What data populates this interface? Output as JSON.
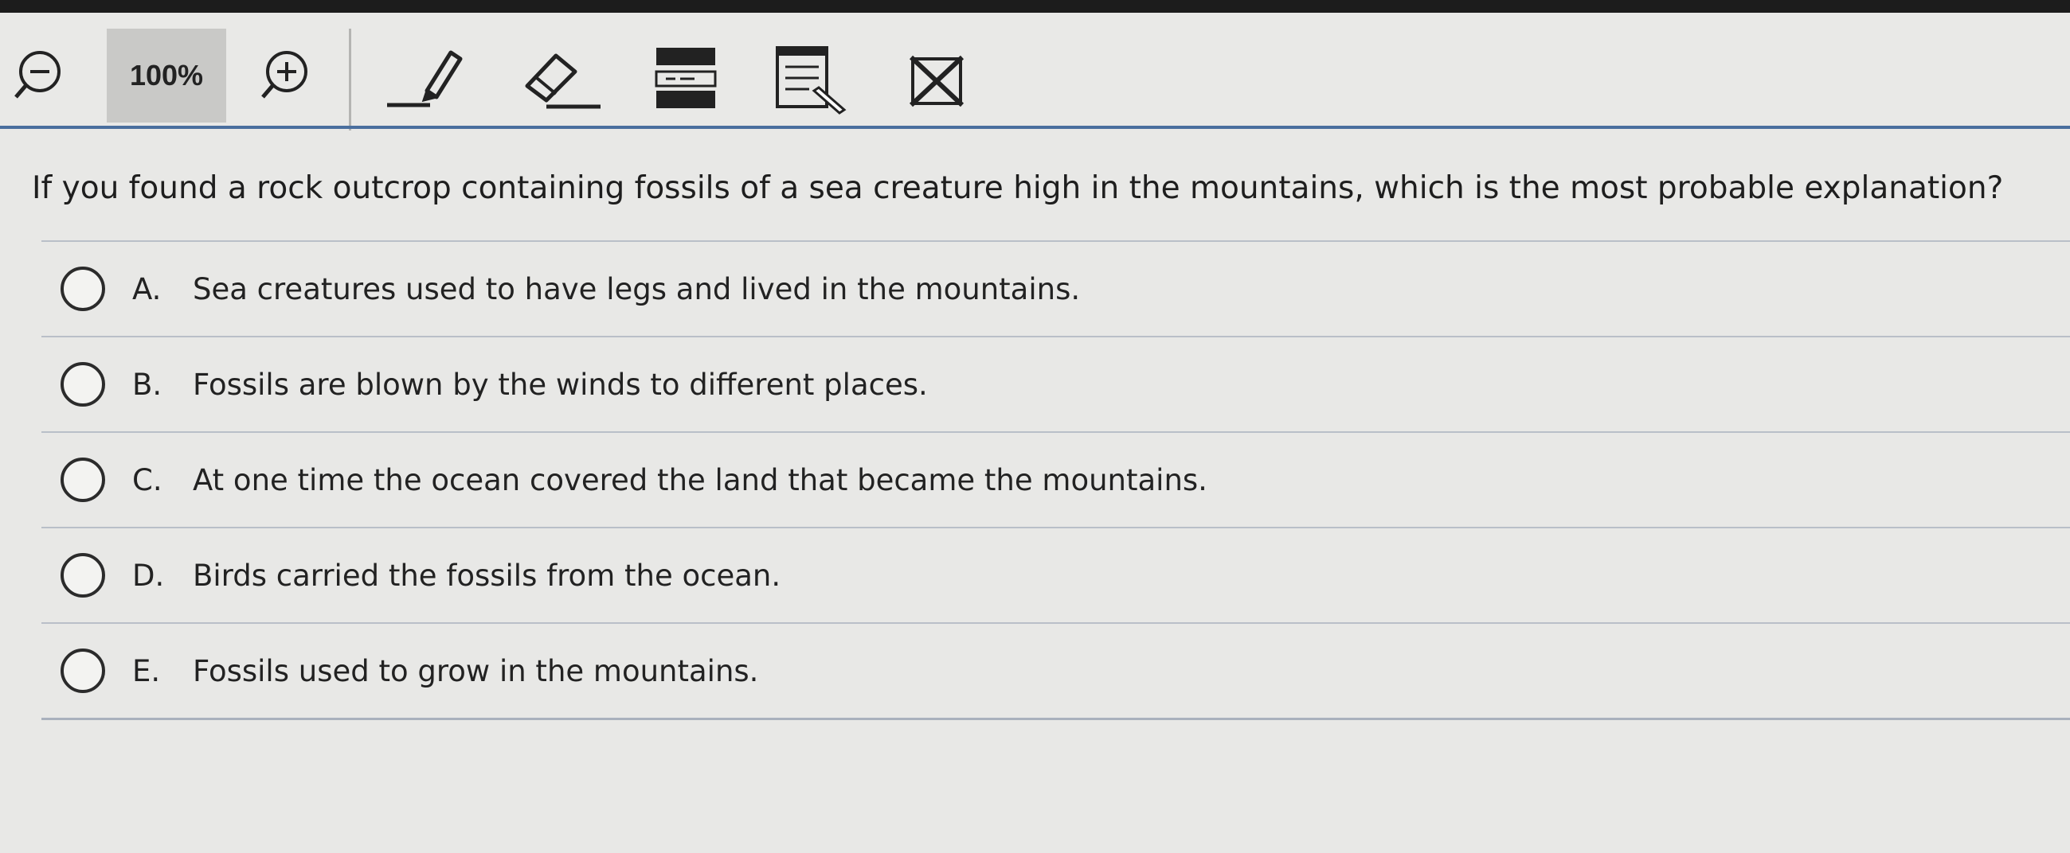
{
  "toolbar": {
    "zoom_level": "100%",
    "icons": [
      "zoom-out-icon",
      "zoom-in-icon",
      "highlighter-icon",
      "eraser-icon",
      "line-reader-icon",
      "notepad-icon",
      "answer-eliminator-icon"
    ],
    "accent_color": "#4a6f9e"
  },
  "question": {
    "text": "If you found a rock outcrop containing fossils of a sea creature high in the mountains, which is the most probable explanation?"
  },
  "choices": [
    {
      "letter": "A.",
      "text": "Sea creatures used to have legs and lived in the mountains."
    },
    {
      "letter": "B.",
      "text": "Fossils are blown by the winds to different places."
    },
    {
      "letter": "C.",
      "text": "At one time the ocean covered the land that became the mountains."
    },
    {
      "letter": "D.",
      "text": "Birds carried the fossils from the ocean."
    },
    {
      "letter": "E.",
      "text": "Fossils used to grow in the mountains."
    }
  ]
}
